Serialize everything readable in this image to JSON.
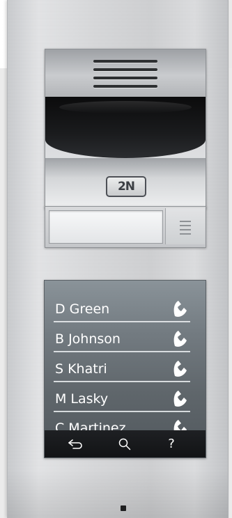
{
  "brand": {
    "logo_text": "2N"
  },
  "contacts": [
    {
      "name": "D Green"
    },
    {
      "name": "B Johnson"
    },
    {
      "name": "S Khatri"
    },
    {
      "name": "M Lasky"
    },
    {
      "name": "C Martinez"
    }
  ],
  "navigation": {
    "back_icon": "back-arrow-icon",
    "search_icon": "search-icon",
    "help_label": "?"
  },
  "name_tag": {
    "text": ""
  },
  "colors": {
    "screen": "#737b81",
    "navbar": "#17181a",
    "text": "#ffffff",
    "panel": "#d7d8da"
  }
}
